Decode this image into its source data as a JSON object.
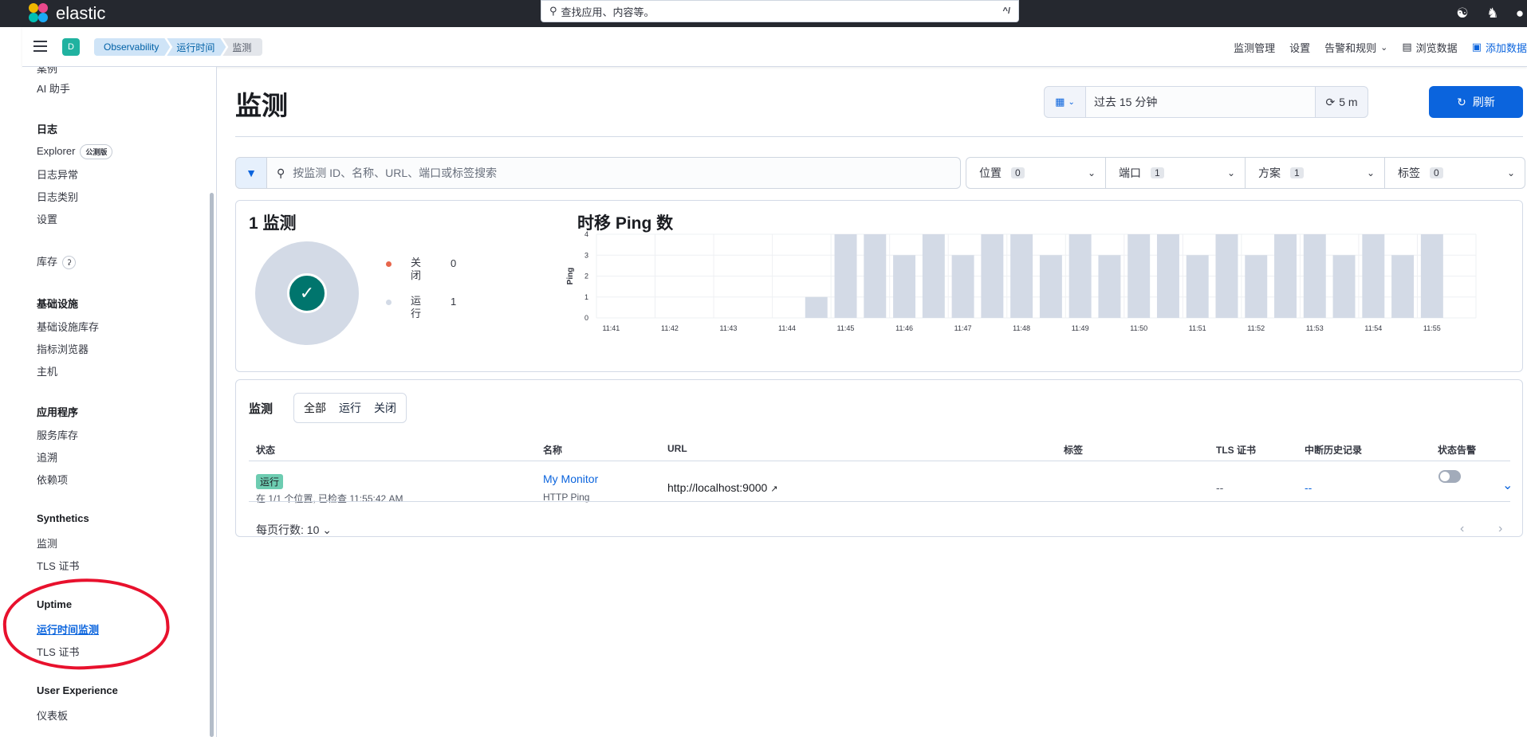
{
  "topbar": {
    "brand": "elastic",
    "search_placeholder": "查找应用、内容等。",
    "search_shortcut": "^/"
  },
  "subbar": {
    "space_initial": "D",
    "breadcrumbs": [
      "Observability",
      "运行时间",
      "监测"
    ],
    "links": {
      "monitor_management": "监测管理",
      "settings": "设置",
      "alerts_rules": "告警和规则",
      "explore_data": "浏览数据",
      "add_data": "添加数据"
    }
  },
  "sidebar": {
    "partial_top": "案例",
    "ai_assistant": "AI 助手",
    "logs_heading": "日志",
    "explorer": "Explorer",
    "explorer_badge": "公测版",
    "log_anomalies": "日志异常",
    "log_categories": "日志类别",
    "logs_settings": "设置",
    "inventory": "库存",
    "infra_heading": "基础设施",
    "infra_inventory": "基础设施库存",
    "metrics_explorer": "指标浏览器",
    "hosts": "主机",
    "apm_heading": "应用程序",
    "service_inventory": "服务库存",
    "traces": "追溯",
    "dependencies": "依赖项",
    "synthetics_heading": "Synthetics",
    "synthetics_monitors": "监测",
    "synthetics_tls": "TLS 证书",
    "uptime_heading": "Uptime",
    "uptime_monitors": "运行时间监测",
    "uptime_tls": "TLS 证书",
    "ux_heading": "User Experience",
    "dashboard": "仪表板"
  },
  "main": {
    "title": "监测",
    "date_range": "过去 15 分钟",
    "refresh_interval": "5 m",
    "refresh_label": "刷新",
    "search_placeholder": "按监测 ID、名称、URL、端口或标签搜索",
    "facets": [
      {
        "label": "位置",
        "count": "0"
      },
      {
        "label": "端口",
        "count": "1"
      },
      {
        "label": "方案",
        "count": "1"
      },
      {
        "label": "标签",
        "count": "0"
      }
    ]
  },
  "summary": {
    "count_title": "1 监测",
    "legend": [
      {
        "label": "关闭",
        "value": "0",
        "color": "#e7664c"
      },
      {
        "label": "运行",
        "value": "1",
        "color": "#d3dae6"
      }
    ],
    "chart_title": "时移 Ping 数"
  },
  "chart_data": {
    "type": "bar",
    "title": "时移 Ping 数",
    "ylabel": "Ping",
    "xlabel": "",
    "ylim": [
      0,
      4
    ],
    "yticks": [
      0,
      1,
      2,
      3,
      4
    ],
    "xtick_labels": [
      "11:41",
      "11:42",
      "11:43",
      "11:44",
      "11:45",
      "11:46",
      "11:47",
      "11:48",
      "11:49",
      "11:50",
      "11:51",
      "11:52",
      "11:53",
      "11:54",
      "11:55"
    ],
    "categories": [
      "11:41:00",
      "11:41:30",
      "11:42:00",
      "11:42:30",
      "11:43:00",
      "11:43:30",
      "11:44:00",
      "11:44:30",
      "11:45:00",
      "11:45:30",
      "11:46:00",
      "11:46:30",
      "11:47:00",
      "11:47:30",
      "11:48:00",
      "11:48:30",
      "11:49:00",
      "11:49:30",
      "11:50:00",
      "11:50:30",
      "11:51:00",
      "11:51:30",
      "11:52:00",
      "11:52:30",
      "11:53:00",
      "11:53:30",
      "11:54:00",
      "11:54:30",
      "11:55:00",
      "11:55:30"
    ],
    "values": [
      0,
      0,
      0,
      0,
      0,
      0,
      0,
      1,
      4,
      4,
      3,
      4,
      3,
      4,
      4,
      3,
      4,
      3,
      4,
      4,
      3,
      4,
      3,
      4,
      4,
      3,
      4,
      3,
      4,
      0
    ],
    "bar_color": "#d3dae6",
    "grid": true
  },
  "table": {
    "title": "监测",
    "filters": [
      "全部",
      "运行",
      "关闭"
    ],
    "headers": [
      "状态",
      "名称",
      "URL",
      "标签",
      "TLS 证书",
      "中断历史记录",
      "状态告警"
    ],
    "row": {
      "status": "运行",
      "status_detail": "在 1/1 个位置, 已检查 11:55:42 AM",
      "name": "My Monitor",
      "type": "HTTP Ping",
      "url": "http://localhost:9000",
      "tls": "--",
      "downtime": "--"
    },
    "rows_per_page": "每页行数: 10"
  }
}
